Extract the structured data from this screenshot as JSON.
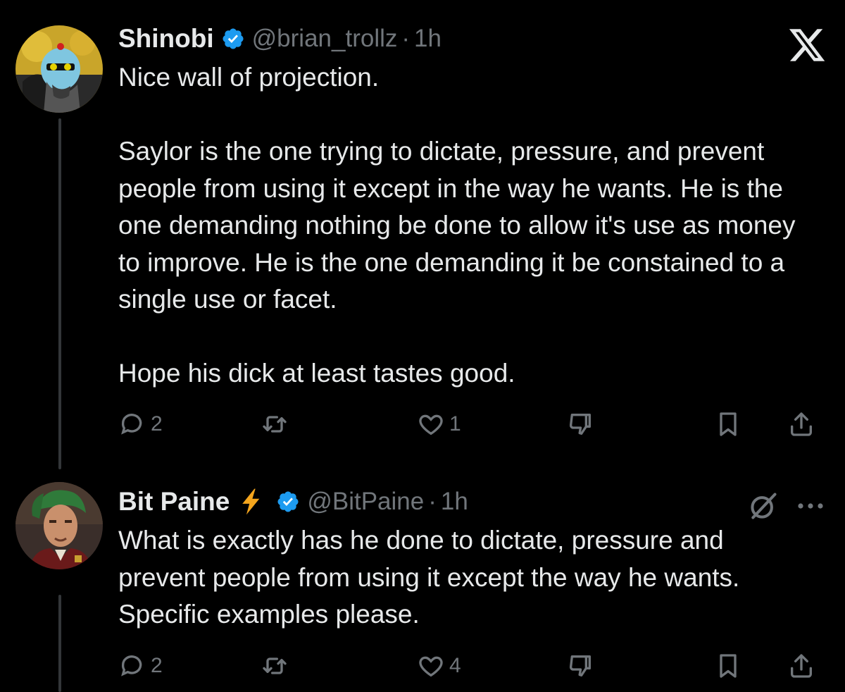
{
  "tweets": [
    {
      "name": "Shinobi",
      "handle": "@brian_trollz",
      "separator": "·",
      "time": "1h",
      "text": "Nice wall of projection.\n\nSaylor is the one trying to dictate, pressure, and prevent people from using it except in the way he wants. He is the one demanding nothing be done to allow it's use as money to improve. He is the one demanding it be constained to a single use or facet.\n\nHope his dick at least tastes good.",
      "replies": "2",
      "likes": "1",
      "verified_color": "#1d9bf0"
    },
    {
      "name": "Bit Paine",
      "handle": "@BitPaine",
      "separator": "·",
      "time": "1h",
      "text": "What is exactly has he done to dictate, pressure and prevent people from using it except the way he wants. Specific examples please.",
      "replies": "2",
      "likes": "4",
      "verified_color": "#1d9bf0",
      "bolt_color": "#f4a51d"
    }
  ],
  "icons": {
    "top_right": "x-logo-icon",
    "grok": "grok-slash-icon",
    "more": "more-dots-icon"
  }
}
